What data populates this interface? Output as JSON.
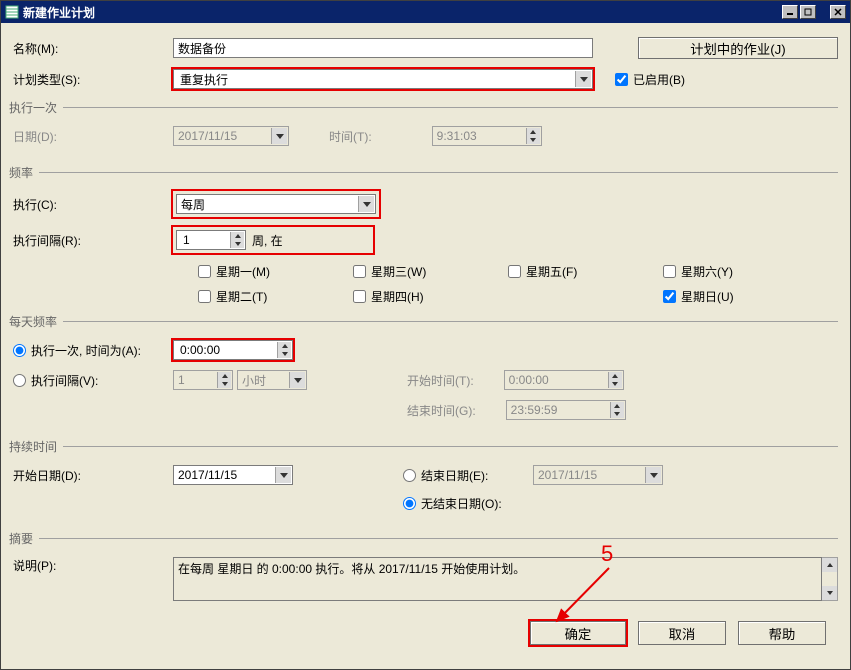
{
  "window": {
    "title": "新建作业计划"
  },
  "header": {
    "name_label": "名称(M):",
    "name_value": "数据备份",
    "plan_type_label": "计划类型(S):",
    "plan_type_value": "重复执行",
    "enabled_label": "已启用(B)",
    "jobs_button": "计划中的作业(J)"
  },
  "once": {
    "legend": "执行一次",
    "date_label": "日期(D):",
    "date_value": "2017/11/15",
    "time_label": "时间(T):",
    "time_value": "9:31:03"
  },
  "freq": {
    "legend": "频率",
    "exec_label": "执行(C):",
    "exec_value": "每周",
    "interval_label": "执行间隔(R):",
    "interval_value": "1",
    "interval_suffix": "周, 在",
    "days": {
      "mon": "星期一(M)",
      "tue": "星期二(T)",
      "wed": "星期三(W)",
      "thu": "星期四(H)",
      "fri": "星期五(F)",
      "sat": "星期六(Y)",
      "sun": "星期日(U)"
    }
  },
  "daily": {
    "legend": "每天频率",
    "once_label": "执行一次, 时间为(A):",
    "once_value": "0:00:00",
    "interval_label": "执行间隔(V):",
    "interval_value": "1",
    "interval_unit": "小时",
    "start_label": "开始时间(T):",
    "start_value": "0:00:00",
    "end_label": "结束时间(G):",
    "end_value": "23:59:59"
  },
  "duration": {
    "legend": "持续时间",
    "start_label": "开始日期(D):",
    "start_value": "2017/11/15",
    "end_radio": "结束日期(E):",
    "end_value": "2017/11/15",
    "noend_radio": "无结束日期(O):"
  },
  "summary": {
    "legend": "摘要",
    "desc_label": "说明(P):",
    "desc_value": "在每周 星期日 的 0:00:00 执行。将从 2017/11/15 开始使用计划。"
  },
  "buttons": {
    "ok": "确定",
    "cancel": "取消",
    "help": "帮助"
  },
  "annotation": {
    "five": "5"
  }
}
